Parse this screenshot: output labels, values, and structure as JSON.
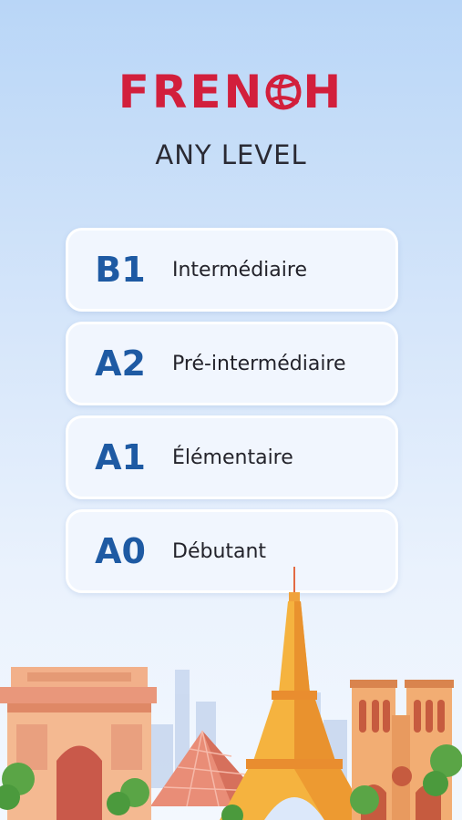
{
  "header": {
    "title_part1": "FREN",
    "title_part2": "H",
    "subtitle": "ANY LEVEL"
  },
  "levels": [
    {
      "code": "B1",
      "name": "Intermédiaire"
    },
    {
      "code": "A2",
      "name": "Pré-intermédiaire"
    },
    {
      "code": "A1",
      "name": "Élémentaire"
    },
    {
      "code": "A0",
      "name": "Débutant"
    }
  ],
  "colors": {
    "brand_red": "#d21f3c",
    "level_blue": "#1e5aa3",
    "card_bg": "#f1f6fe"
  },
  "icons": {
    "title_letter_c": "volleyball-icon",
    "illustration": "paris-landmarks-illustration"
  }
}
